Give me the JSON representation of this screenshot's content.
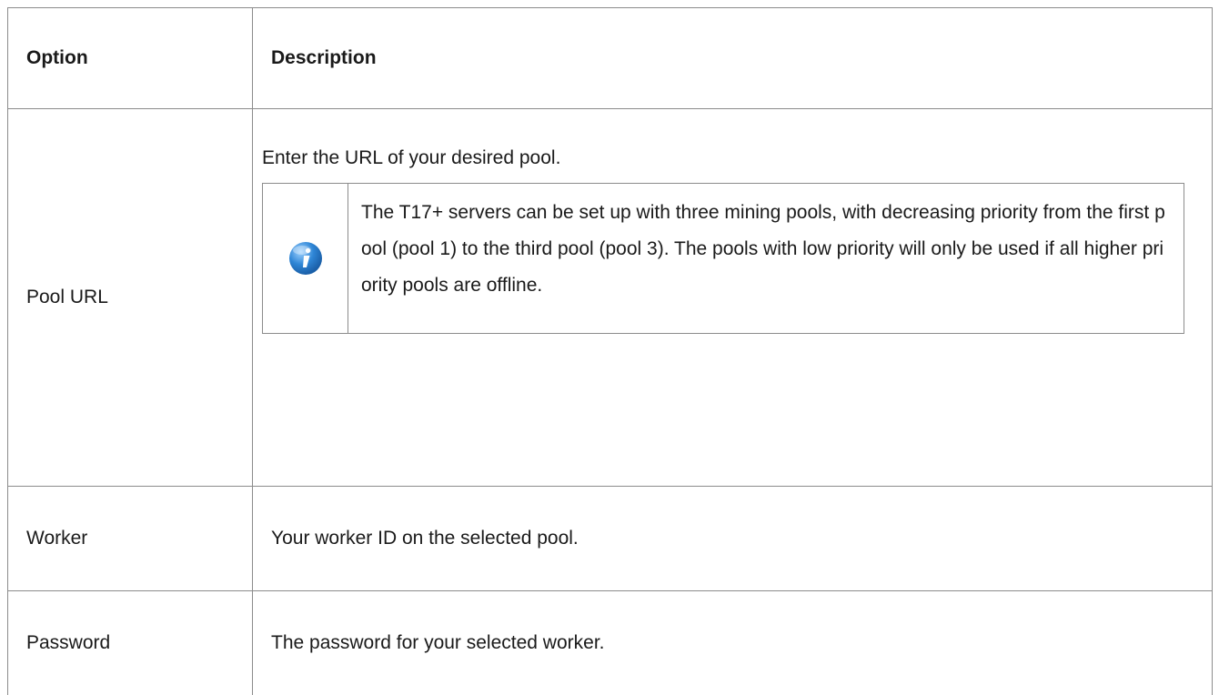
{
  "table": {
    "headers": {
      "option": "Option",
      "description": "Description"
    },
    "rows": [
      {
        "option": "Pool URL",
        "description": "Enter the URL of your desired pool.",
        "note": {
          "icon": "info-icon",
          "text": "The T17+ servers can be set up with three mining pools, with decreasing priority from the first pool (pool 1) to the third pool (pool 3). The pools with low priority will only be used if all higher priority pools are offline."
        }
      },
      {
        "option": "Worker",
        "description": "Your worker ID on the selected pool."
      },
      {
        "option": "Password",
        "description": "The password for your selected worker."
      }
    ]
  },
  "colors": {
    "border": "#8c8c8c",
    "icon_blue": "#2f86d6"
  }
}
